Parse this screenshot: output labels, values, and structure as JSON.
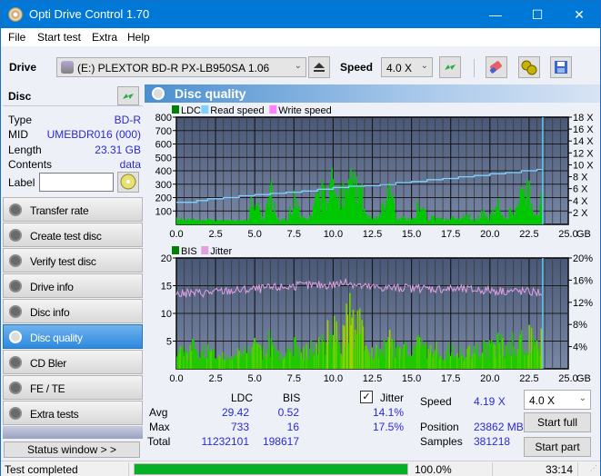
{
  "window": {
    "title": "Opti Drive Control 1.70",
    "minimize": "—",
    "maximize": "☐",
    "close": "✕"
  },
  "menu": [
    "File",
    "Start test",
    "Extra",
    "Help"
  ],
  "toolbar": {
    "drive_label": "Drive",
    "drive_value": "(E:)  PLEXTOR BD-R  PX-LB950SA 1.06",
    "speed_label": "Speed",
    "speed_value": "4.0 X"
  },
  "disc": {
    "header": "Disc",
    "rows": [
      {
        "key": "Type",
        "value": "BD-R"
      },
      {
        "key": "MID",
        "value": "UMEBDR016 (000)"
      },
      {
        "key": "Length",
        "value": "23.31 GB"
      },
      {
        "key": "Contents",
        "value": "data"
      }
    ],
    "label_key": "Label",
    "label_value": ""
  },
  "nav": [
    {
      "label": "Transfer rate",
      "active": false
    },
    {
      "label": "Create test disc",
      "active": false
    },
    {
      "label": "Verify test disc",
      "active": false
    },
    {
      "label": "Drive info",
      "active": false
    },
    {
      "label": "Disc info",
      "active": false
    },
    {
      "label": "Disc quality",
      "active": true
    },
    {
      "label": "CD Bler",
      "active": false
    },
    {
      "label": "FE / TE",
      "active": false
    },
    {
      "label": "Extra tests",
      "active": false
    }
  ],
  "status_window_button": "Status window > >",
  "panel": {
    "title": "Disc quality"
  },
  "chart_data": [
    {
      "type": "bar",
      "title": "LDC / Read speed",
      "legend": [
        {
          "name": "LDC",
          "color": "#008000"
        },
        {
          "name": "Read speed",
          "color": "#80d0ff"
        },
        {
          "name": "Write speed",
          "color": "#ff80ff"
        }
      ],
      "legend_position": "top-left",
      "x_ticks": [
        "0.0",
        "2.5",
        "5.0",
        "7.5",
        "10.0",
        "12.5",
        "15.0",
        "17.5",
        "20.0",
        "22.5",
        "25.0"
      ],
      "x_unit": "GB",
      "xlim": [
        0,
        25
      ],
      "ylim_left": [
        0,
        800
      ],
      "y_ticks_left": [
        "100",
        "200",
        "300",
        "400",
        "500",
        "600",
        "700",
        "800"
      ],
      "ylim_right": [
        0,
        18
      ],
      "y_ticks_right": [
        "2 X",
        "4 X",
        "6 X",
        "8 X",
        "10 X",
        "12 X",
        "14 X",
        "16 X",
        "18 X"
      ],
      "grid": true,
      "series": [
        {
          "name": "LDC",
          "x": [
            0,
            0.5,
            1,
            1.5,
            2,
            2.5,
            3,
            3.5,
            4,
            4.5,
            4.9,
            5.5,
            6,
            6.5,
            7,
            7.5,
            8,
            8.5,
            9,
            9.5,
            10,
            10.5,
            10.9,
            11.3,
            11.7,
            12,
            12.5,
            13,
            13.5,
            14,
            14.5,
            15,
            15.5,
            16,
            16.5,
            17,
            17.5,
            18,
            18.5,
            19,
            19.5,
            20,
            20.5,
            21,
            21.5,
            22,
            22.5,
            23,
            23.3
          ],
          "values": [
            70,
            40,
            50,
            30,
            45,
            35,
            30,
            25,
            30,
            30,
            340,
            30,
            330,
            40,
            50,
            260,
            60,
            70,
            290,
            380,
            550,
            250,
            733,
            440,
            400,
            120,
            50,
            130,
            430,
            50,
            60,
            40,
            250,
            60,
            70,
            40,
            60,
            50,
            90,
            60,
            120,
            90,
            200,
            60,
            220,
            320,
            330,
            120,
            340
          ]
        },
        {
          "name": "Read speed",
          "x": [
            0,
            1.3,
            2,
            3,
            4,
            5,
            6,
            7,
            8,
            9,
            10,
            11,
            12,
            13,
            14,
            15,
            16,
            17,
            18,
            19,
            20,
            21,
            22,
            23,
            23.31
          ],
          "values": [
            3.7,
            4.0,
            4.3,
            4.5,
            4.8,
            5.0,
            5.2,
            5.4,
            5.6,
            5.9,
            6.2,
            6.4,
            6.5,
            6.7,
            7.0,
            7.2,
            7.5,
            7.7,
            8.0,
            8.2,
            8.5,
            8.7,
            9.0,
            9.2,
            9.3
          ]
        }
      ]
    },
    {
      "type": "bar",
      "title": "BIS / Jitter",
      "legend": [
        {
          "name": "BIS",
          "color": "#008000"
        },
        {
          "name": "Jitter",
          "color": "#e0a0e0"
        }
      ],
      "legend_position": "top-left",
      "x_ticks": [
        "0.0",
        "2.5",
        "5.0",
        "7.5",
        "10.0",
        "12.5",
        "15.0",
        "17.5",
        "20.0",
        "22.5",
        "25.0"
      ],
      "x_unit": "GB",
      "xlim": [
        0,
        25
      ],
      "ylim_left": [
        0,
        20
      ],
      "y_ticks_left": [
        "5",
        "10",
        "15",
        "20"
      ],
      "ylim_right": [
        0,
        20
      ],
      "y_ticks_right": [
        "4%",
        "8%",
        "12%",
        "16%",
        "20%"
      ],
      "grid": true,
      "series": [
        {
          "name": "BIS",
          "x": [
            0,
            0.5,
            1,
            1.5,
            2,
            2.5,
            3,
            3.5,
            4,
            4.5,
            5,
            5.5,
            6,
            6.5,
            7,
            7.5,
            8,
            8.5,
            9,
            9.5,
            10,
            10.5,
            10.9,
            11.3,
            11.7,
            12,
            12.5,
            13,
            13.5,
            14,
            14.5,
            15,
            15.5,
            16,
            16.5,
            17,
            17.5,
            18,
            18.5,
            19,
            19.5,
            20,
            20.5,
            21,
            21.5,
            22,
            22.5,
            23,
            23.3
          ],
          "values": [
            5,
            4,
            6,
            4,
            5,
            3,
            4,
            3,
            4,
            4,
            7,
            4,
            8,
            3,
            4,
            6,
            4,
            5,
            6,
            8,
            12,
            7,
            16,
            10,
            11,
            5,
            4,
            5,
            8,
            4,
            5,
            4,
            8,
            4,
            5,
            4,
            5,
            4,
            5,
            4,
            6,
            5,
            7,
            5,
            7,
            7,
            8,
            5,
            8
          ]
        },
        {
          "name": "Jitter",
          "x": [
            0,
            2,
            4,
            6,
            8,
            10,
            11,
            12,
            14,
            16,
            18,
            20,
            22,
            23.3
          ],
          "values": [
            13.5,
            13.8,
            14.2,
            14.6,
            15.0,
            15.2,
            15.6,
            14.8,
            14.6,
            14.5,
            14.4,
            14.2,
            14.0,
            13.8
          ]
        }
      ]
    }
  ],
  "stats": {
    "col_ldc": "LDC",
    "col_bis": "BIS",
    "jitter_label": "Jitter",
    "jitter_checked": true,
    "rows": [
      {
        "label": "Avg",
        "ldc": "29.42",
        "bis": "0.52",
        "jitter": "14.1%"
      },
      {
        "label": "Max",
        "ldc": "733",
        "bis": "16",
        "jitter": "17.5%"
      },
      {
        "label": "Total",
        "ldc": "11232101",
        "bis": "198617",
        "jitter": ""
      }
    ],
    "speed_label": "Speed",
    "speed_value": "4.19 X",
    "position_label": "Position",
    "position_value": "23862 MB",
    "samples_label": "Samples",
    "samples_value": "381218",
    "speed_select": "4.0 X",
    "start_full": "Start full",
    "start_part": "Start part"
  },
  "statusbar": {
    "text": "Test completed",
    "progress_percent": 100.0,
    "progress_label": "100.0%",
    "time": "33:14"
  }
}
